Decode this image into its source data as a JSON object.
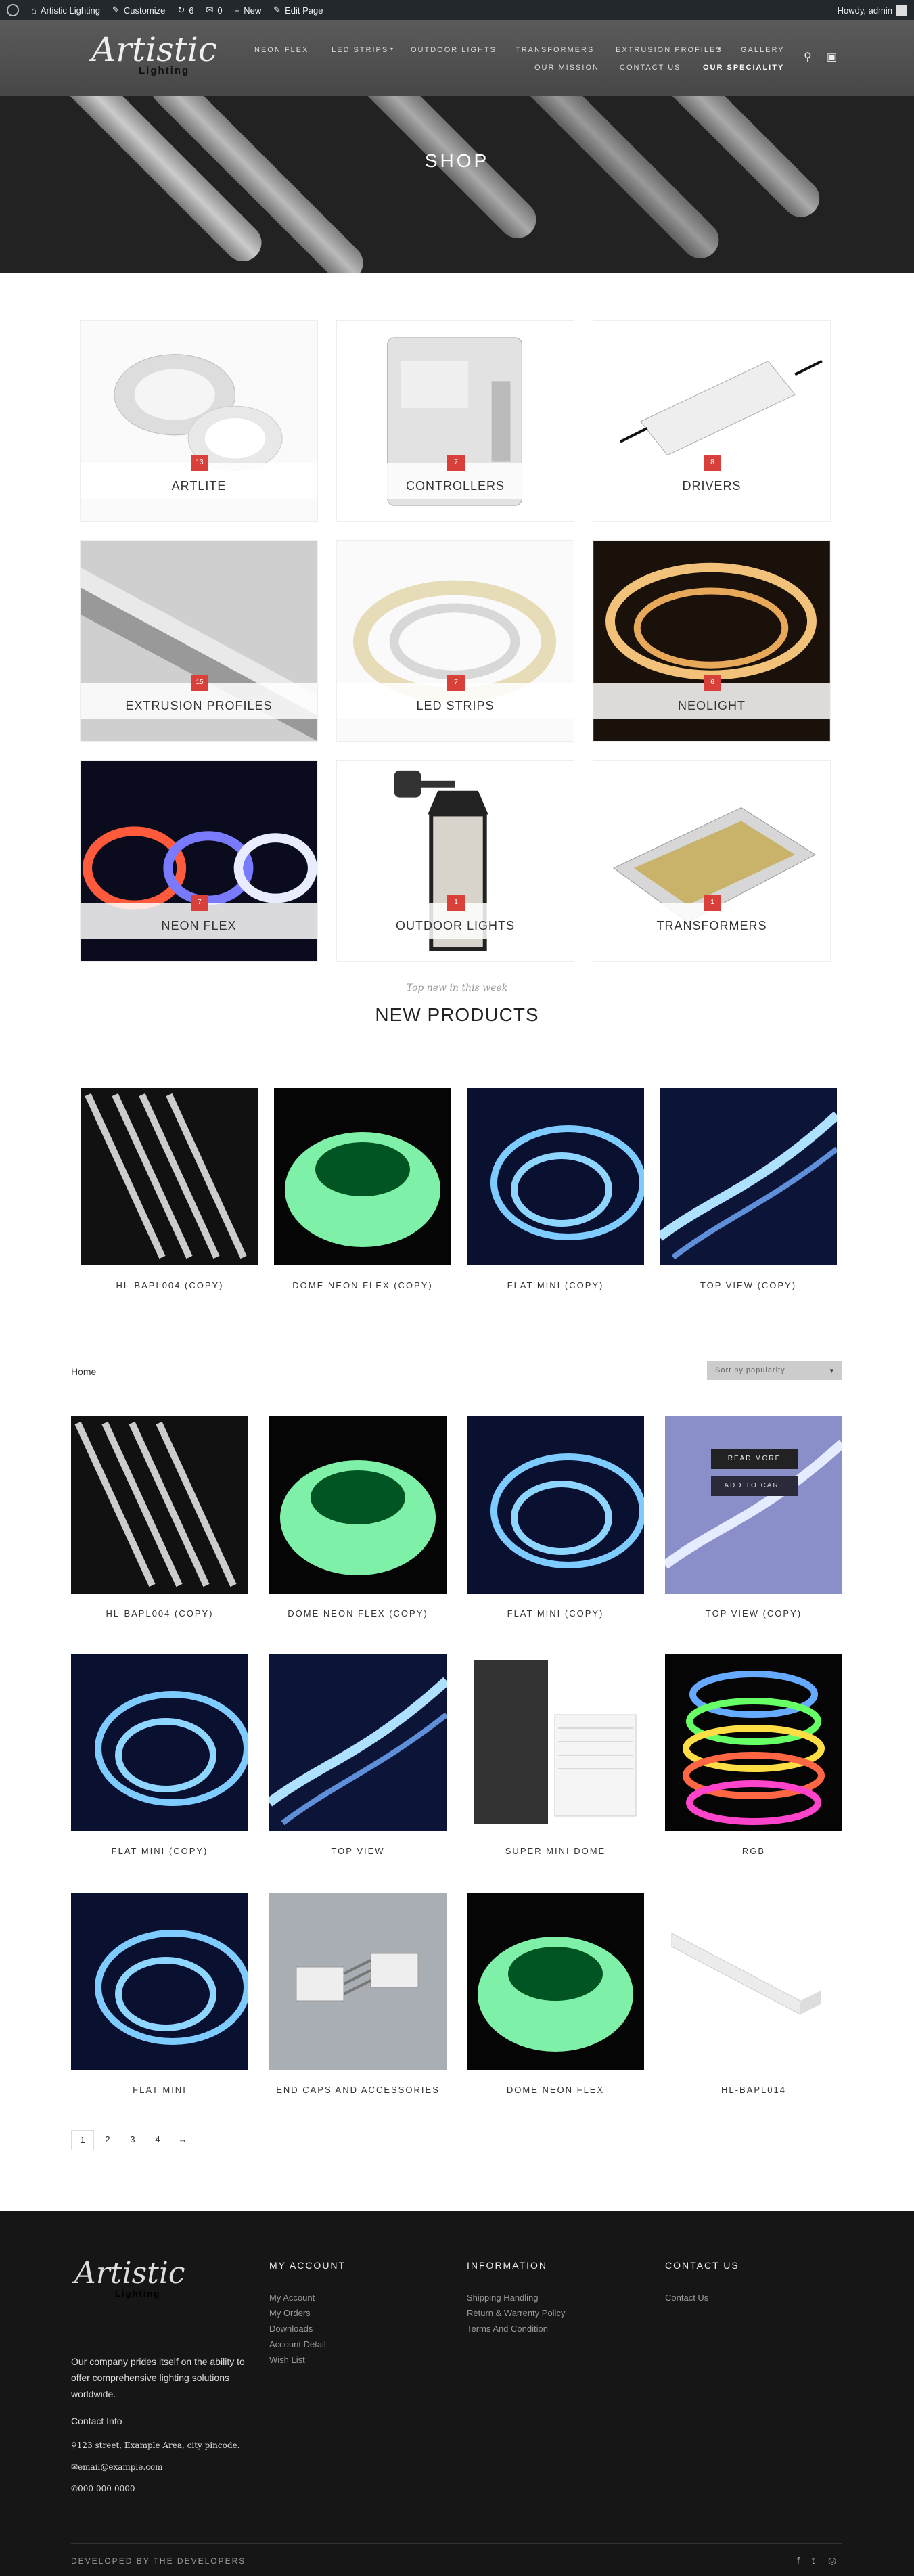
{
  "admin_bar": {
    "site": "Artistic Lighting",
    "customize": "Customize",
    "updates": "6",
    "comments": "0",
    "new": "New",
    "edit": "Edit Page",
    "howdy": "Howdy, admin"
  },
  "logo": {
    "main": "Artistic",
    "sub": "Lighting"
  },
  "nav": {
    "row1": [
      "NEON FLEX",
      "LED STRIPS",
      "OUTDOOR LIGHTS",
      "TRANSFORMERS",
      "EXTRUSION PROFILES",
      "GALLERY"
    ],
    "row2": [
      "OUR MISSION",
      "CONTACT US",
      "OUR SPECIALITY"
    ]
  },
  "hero": {
    "title": "SHOP"
  },
  "categories": [
    {
      "name": "ARTLITE",
      "count": "13"
    },
    {
      "name": "CONTROLLERS",
      "count": "7"
    },
    {
      "name": "DRIVERS",
      "count": "8"
    },
    {
      "name": "EXTRUSION PROFILES",
      "count": "15"
    },
    {
      "name": "LED STRIPS",
      "count": "7"
    },
    {
      "name": "NEOLIGHT",
      "count": "6"
    },
    {
      "name": "NEON FLEX",
      "count": "7"
    },
    {
      "name": "OUTDOOR LIGHTS",
      "count": "1"
    },
    {
      "name": "TRANSFORMERS",
      "count": "1"
    }
  ],
  "new_products": {
    "subtitle": "Top new in this week",
    "title": "NEW PRODUCTS",
    "items": [
      "HL-BAPL004 (COPY)",
      "DOME NEON FLEX (COPY)",
      "FLAT MINI (COPY)",
      "TOP VIEW (COPY)"
    ]
  },
  "shop": {
    "breadcrumb": "Home",
    "sort": "Sort by popularity",
    "hover_read_more": "READ MORE",
    "hover_add": "ADD TO CART",
    "products": [
      "HL-BAPL004 (COPY)",
      "DOME NEON FLEX (COPY)",
      "FLAT MINI (COPY)",
      "TOP VIEW (COPY)",
      "FLAT MINI (COPY)",
      "TOP VIEW",
      "SUPER MINI DOME",
      "RGB",
      "FLAT MINI",
      "END CAPS AND ACCESSORIES",
      "DOME NEON FLEX",
      "HL-BAPL014"
    ]
  },
  "pagination": [
    "1",
    "2",
    "3",
    "4",
    "→"
  ],
  "footer": {
    "about": "Our company prides itself on the ability to offer comprehensive lighting solutions worldwide.",
    "contact_info_label": "Contact Info",
    "address": "123 street, Example Area, city pincode.",
    "email": "email@example.com",
    "phone": "000-000-0000",
    "my_account": {
      "title": "MY ACCOUNT",
      "links": [
        "My Account",
        "My Orders",
        "Downloads",
        "Account Detail",
        "Wish List"
      ]
    },
    "information": {
      "title": "INFORMATION",
      "links": [
        "Shipping Handling",
        "Return & Warrenty Policy",
        "Terms And Condition"
      ]
    },
    "contact": {
      "title": "CONTACT US",
      "links": [
        "Contact Us"
      ]
    },
    "copyright": "DEVELOPED BY THE DEVELOPERS"
  }
}
